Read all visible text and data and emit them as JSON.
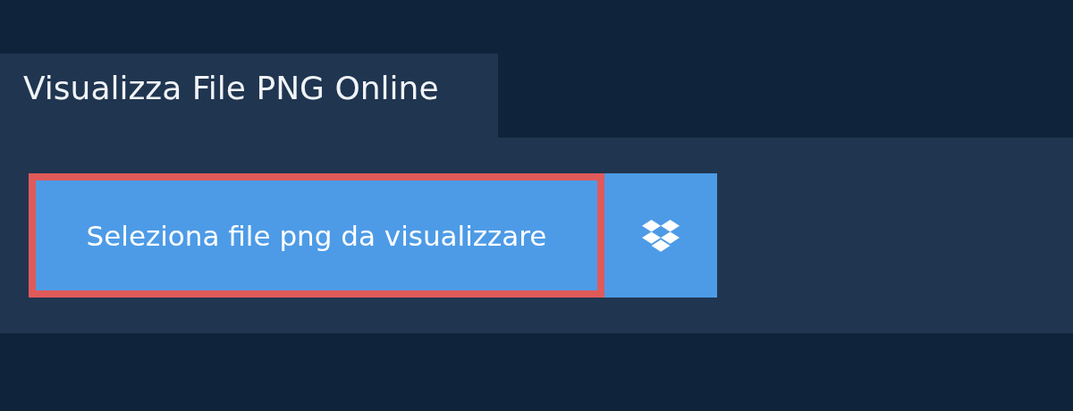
{
  "tab": {
    "title": "Visualizza File PNG Online"
  },
  "upload": {
    "label": "Seleziona file png da visualizzare",
    "highlighted": true
  }
}
